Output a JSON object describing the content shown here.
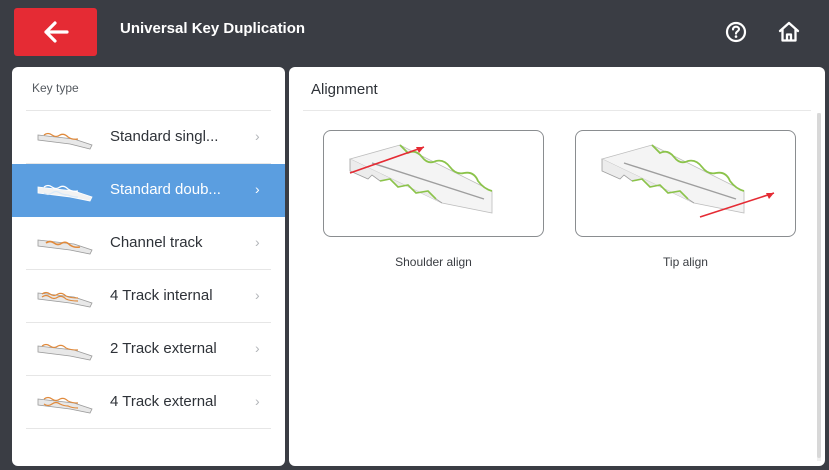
{
  "header": {
    "title": "Universal Key Duplication",
    "back_icon": "arrow-left-icon",
    "help_icon": "help-circle-icon",
    "home_icon": "home-icon"
  },
  "sidebar": {
    "header": "Key type",
    "selected_index": 1,
    "items": [
      {
        "label": "Standard singl...",
        "icon": "key-single-side-icon"
      },
      {
        "label": "Standard doub...",
        "icon": "key-double-side-icon"
      },
      {
        "label": "Channel track",
        "icon": "key-channel-track-icon"
      },
      {
        "label": "4 Track internal",
        "icon": "key-4-track-internal-icon"
      },
      {
        "label": "2 Track external",
        "icon": "key-2-track-external-icon"
      },
      {
        "label": "4 Track external",
        "icon": "key-4-track-external-icon"
      }
    ],
    "chevron": "›"
  },
  "main": {
    "title": "Alignment",
    "options": [
      {
        "label": "Shoulder align",
        "icon": "shoulder-align-diagram"
      },
      {
        "label": "Tip align",
        "icon": "tip-align-diagram"
      }
    ]
  },
  "colors": {
    "topbar": "#3a3d44",
    "back_button": "#e52b34",
    "selected_row": "#5b9ee0",
    "key_cut": "#8bc34a",
    "arrow": "#e52b34"
  }
}
